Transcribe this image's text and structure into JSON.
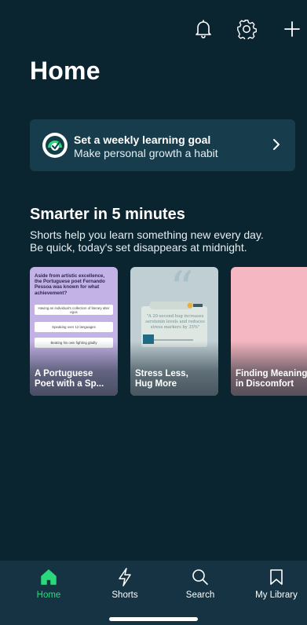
{
  "header": {
    "title": "Home",
    "icons": [
      "bell-icon",
      "gear-icon",
      "plus-icon"
    ]
  },
  "goal_card": {
    "title": "Set a weekly learning goal",
    "subtitle": "Make personal growth a habit",
    "icon": "goal-target-icon"
  },
  "shorts_section": {
    "title": "Smarter in 5 minutes",
    "description_line1": "Shorts help you learn something new every day.",
    "description_line2": "Be quick, today's set disappears at midnight.",
    "cards": [
      {
        "label_line1": "A Portuguese",
        "label_line2": "Poet with a Sp...",
        "quiz_question": "Aside from artistic excellence, the Portuguese poet Fernando Pessoa was known for what achievement?",
        "quiz_options": [
          "Having an individual's collection of literary alter egos",
          "Speaking over 12 languages",
          "Beating his own fighting gladly"
        ]
      },
      {
        "label_line1": "Stress Less,",
        "label_line2": "Hug More",
        "quote": "\"A 20-second hug increases serotonin levels and reduces stress markers by 35%\""
      },
      {
        "label_line1": "Finding Meaning",
        "label_line2": "in Discomfort"
      }
    ]
  },
  "bottom_nav": {
    "items": [
      {
        "label": "Home",
        "icon": "home-icon",
        "active": true
      },
      {
        "label": "Shorts",
        "icon": "lightning-icon",
        "active": false
      },
      {
        "label": "Search",
        "icon": "search-icon",
        "active": false
      },
      {
        "label": "My Library",
        "icon": "bookmark-icon",
        "active": false
      }
    ]
  },
  "colors": {
    "background": "#0b2530",
    "card": "#173c4b",
    "nav": "#153342",
    "accent": "#2bd97c"
  }
}
